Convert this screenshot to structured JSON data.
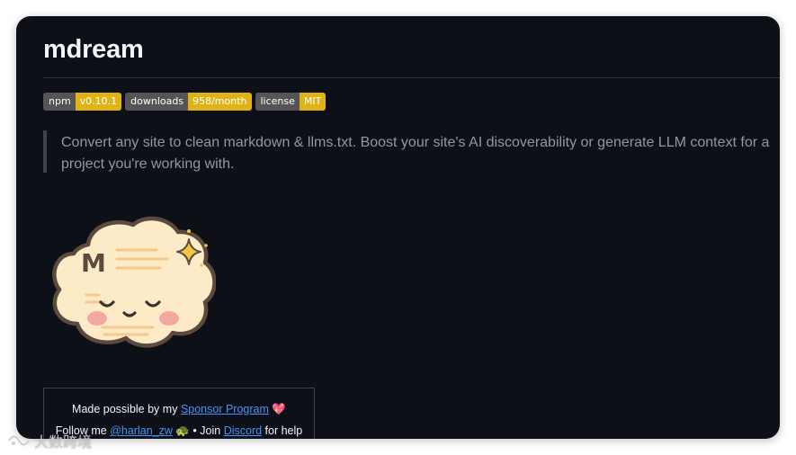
{
  "readme": {
    "title": "mdream",
    "badges": [
      {
        "label": "npm",
        "value": "v0.10.1"
      },
      {
        "label": "downloads",
        "value": "958/month"
      },
      {
        "label": "license",
        "value": "MIT"
      }
    ],
    "badge_value_color": "#dfb317",
    "description": "Convert any site to clean markdown & llms.txt. Boost your site's AI discoverability or generate LLM context for a project you're working with.",
    "mascot_letter": "M",
    "sponsor": {
      "line1_prefix": "Made possible by my",
      "line1_link": "Sponsor Program",
      "line1_emoji": "💖",
      "line2_prefix": "Follow me",
      "line2_handle": "@harlan_zw",
      "line2_emoji": "🐢",
      "line2_middle": "• Join",
      "line2_link": "Discord",
      "line2_suffix": "for help"
    }
  },
  "watermark": {
    "text": "大数跨境"
  }
}
